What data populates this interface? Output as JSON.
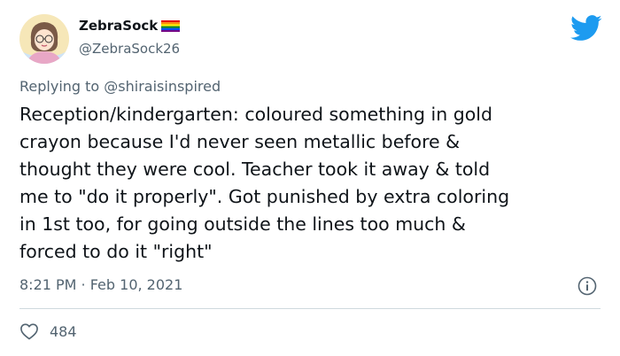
{
  "tweet": {
    "author": {
      "display_name": "ZebraSock",
      "handle": "@ZebraSock26",
      "avatar_icon": "cartoon-woman-avatar",
      "flag_icon": "rainbow-flag"
    },
    "reply_prefix": "Replying to ",
    "reply_to": "@shiraisinspired",
    "text": "Reception/kindergarten: coloured something in gold\ncrayon because I'd never seen metallic before &\nthought they were cool. Teacher took it away & told\nme to \"do it properly\". Got punished by extra coloring\nin 1st too, for going outside the lines too much &\nforced to do it \"right\"",
    "timestamp": "8:21 PM · Feb 10, 2021",
    "like_count": "484"
  },
  "colors": {
    "brand_blue": "#1d9bf0",
    "muted": "#536471",
    "text": "#0f1419",
    "divider": "#cfd9de"
  },
  "icons": {
    "brand": "twitter-bird-icon",
    "info": "info-icon",
    "like": "heart-icon"
  }
}
